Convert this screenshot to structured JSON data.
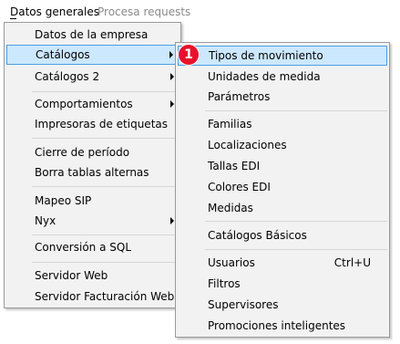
{
  "menubar": {
    "datos_generales": "Datos generales",
    "procesa_requests": "Procesa requests"
  },
  "menu_datos": {
    "empresa": "Datos de la empresa",
    "catalogos": "Catálogos",
    "catalogos2": "Catálogos 2",
    "comportamientos": "Comportamientos",
    "impresoras": "Impresoras de etiquetas",
    "cierre": "Cierre de período",
    "borra": "Borra tablas alternas",
    "mapeo": "Mapeo SIP",
    "nyx": "Nyx",
    "conversion": "Conversión a SQL",
    "servidor_web": "Servidor Web",
    "servidor_fact": "Servidor Facturación Web"
  },
  "submenu_catalogos": {
    "tipos": "Tipos de movimiento",
    "unidades": "Unidades de medida",
    "parametros": "Parámetros",
    "familias": "Familias",
    "localizaciones": "Localizaciones",
    "tallas": "Tallas EDI",
    "colores": "Colores EDI",
    "medidas": "Medidas",
    "basicos": "Catálogos Básicos",
    "usuarios": "Usuarios",
    "usuarios_shortcut": "Ctrl+U",
    "filtros": "Filtros",
    "supervisores": "Supervisores",
    "promociones": "Promociones inteligentes"
  },
  "annotation": {
    "step": "1",
    "color": "#e8112d"
  },
  "colors": {
    "highlight_bg": "#cce8ff",
    "highlight_border": "#4c9ee3",
    "menu_bg": "#f2f2f2",
    "disabled_text": "#8a8a8a"
  }
}
